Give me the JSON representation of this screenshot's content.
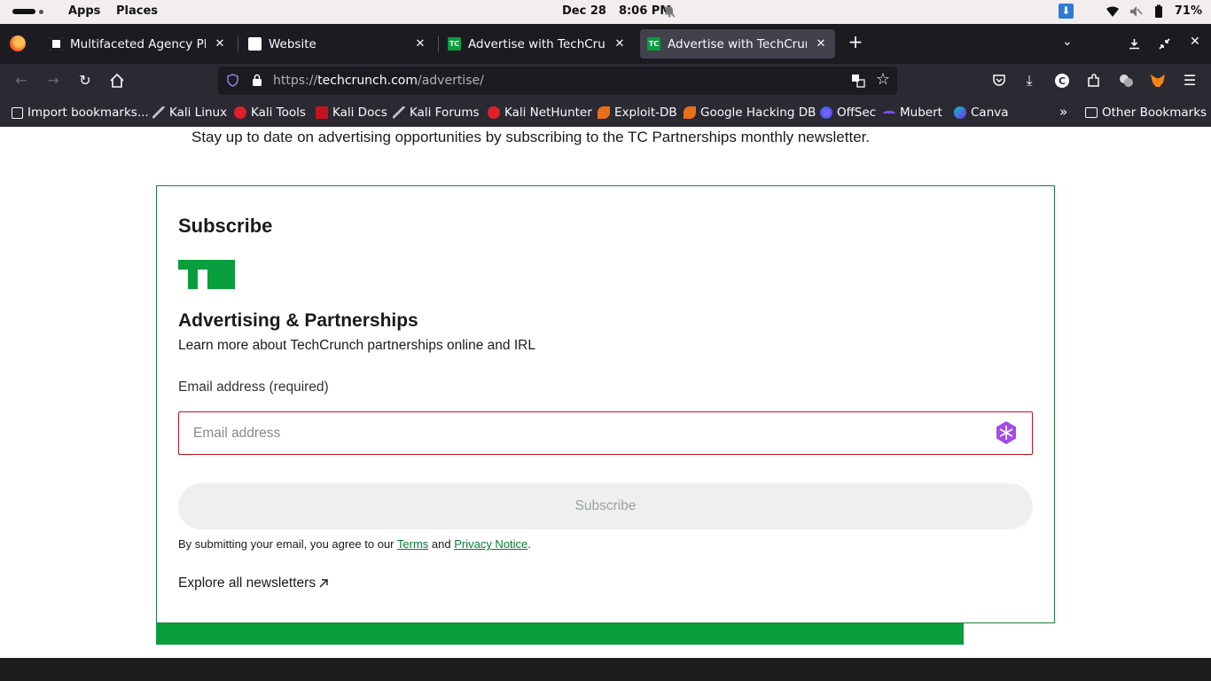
{
  "system_bar": {
    "apps": "Apps",
    "places": "Places",
    "date": "Dec 28",
    "time": "8:06 PM",
    "battery": "71%"
  },
  "tabs": [
    {
      "title": "Multifaceted Agency Plan",
      "favicon": "chatgpt-icon",
      "active": false
    },
    {
      "title": "Website",
      "favicon": "website-icon",
      "active": false
    },
    {
      "title": "Advertise with TechCrunch",
      "favicon": "techcrunch-icon",
      "active": false
    },
    {
      "title": "Advertise with TechCrunch",
      "favicon": "techcrunch-icon",
      "active": true
    }
  ],
  "address_bar": {
    "protocol": "https://",
    "host": "techcrunch.com",
    "path": "/advertise/"
  },
  "bookmarks": [
    {
      "label": "Import bookmarks...",
      "icon": "import-icon"
    },
    {
      "label": "Kali Linux",
      "icon": "kali-dragon-icon"
    },
    {
      "label": "Kali Tools",
      "icon": "kali-tools-icon"
    },
    {
      "label": "Kali Docs",
      "icon": "kali-docs-icon"
    },
    {
      "label": "Kali Forums",
      "icon": "kali-forums-icon"
    },
    {
      "label": "Kali NetHunter",
      "icon": "kali-nethunter-icon"
    },
    {
      "label": "Exploit-DB",
      "icon": "exploit-db-icon"
    },
    {
      "label": "Google Hacking DB",
      "icon": "ghdb-icon"
    },
    {
      "label": "OffSec",
      "icon": "offsec-icon"
    },
    {
      "label": "Mubert",
      "icon": "mubert-icon"
    },
    {
      "label": "Canva",
      "icon": "canva-icon"
    }
  ],
  "other_bookmarks": "Other Bookmarks",
  "page": {
    "intro": "Stay up to date on advertising opportunities by subscribing to the TC Partnerships monthly newsletter.",
    "card_heading": "Subscribe",
    "newsletter_title": "Advertising & Partnerships",
    "newsletter_desc": "Learn more about TechCrunch partnerships online and IRL",
    "email_label": "Email address (required)",
    "email_placeholder": "Email address",
    "subscribe_label": "Subscribe",
    "legal_prefix": "By submitting your email, you agree to our ",
    "terms_label": "Terms",
    "legal_and": " and ",
    "privacy_label": "Privacy Notice",
    "legal_suffix": ".",
    "explore_label": "Explore all newsletters"
  },
  "colors": {
    "brand_green": "#0a9e3f",
    "input_border_error": "#c0141e",
    "browser_dark": "#2b2a33"
  }
}
